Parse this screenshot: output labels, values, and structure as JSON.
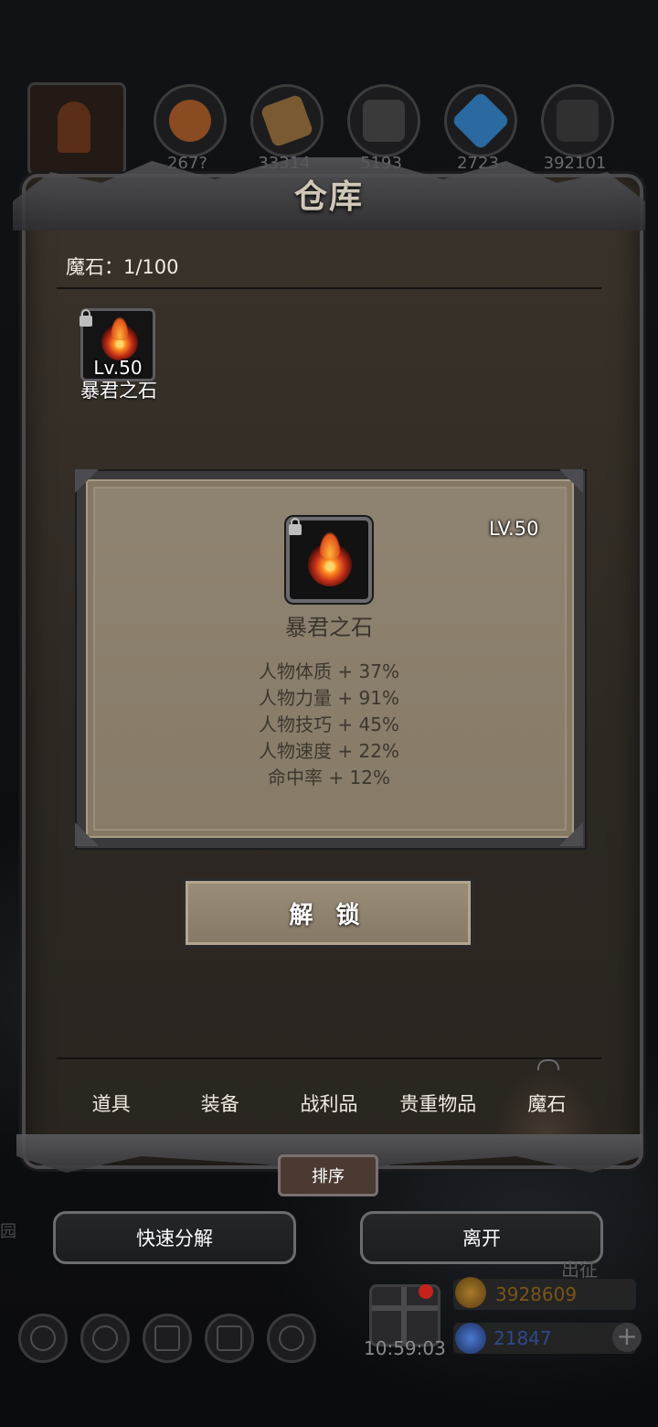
{
  "resources": {
    "items": [
      {
        "value": "",
        "icon": "horn-icon",
        "color": "#5a2e18"
      },
      {
        "value": "267?",
        "icon": "meat-icon",
        "color": "#8a4a22"
      },
      {
        "value": "33314",
        "icon": "wood-icon",
        "color": "#7a5a32"
      },
      {
        "value": "5193",
        "icon": "stone-icon",
        "color": "#3a3a3a"
      },
      {
        "value": "2723",
        "icon": "crystal-icon",
        "color": "#2a6aa0"
      },
      {
        "value": "392101",
        "icon": "iron-icon",
        "color": "#303030"
      }
    ]
  },
  "panel": {
    "title": "仓库",
    "count_label": "魔石：1/100"
  },
  "inventory": {
    "item": {
      "level": "Lv.50",
      "name": "暴君之石",
      "locked": true,
      "icon": "fire-stone-icon"
    }
  },
  "detail": {
    "level": "LV.50",
    "name": "暴君之石",
    "stats": [
      "人物体质 + 37%",
      "人物力量 + 91%",
      "人物技巧 + 45%",
      "人物速度 + 22%",
      "命中率 + 12%"
    ],
    "unlock_label": "解 锁"
  },
  "tabs": [
    {
      "label": "道具",
      "active": false
    },
    {
      "label": "装备",
      "active": false
    },
    {
      "label": "战利品",
      "active": false
    },
    {
      "label": "贵重物品",
      "active": false
    },
    {
      "label": "魔石",
      "active": true
    }
  ],
  "actions": {
    "sort_label": "排序",
    "quick_decompose_label": "快速分解",
    "leave_label": "离开"
  },
  "hud": {
    "timer": "10:59:03",
    "gold": "3928609",
    "gems": "21847",
    "plus": "+",
    "expedition": "出征",
    "side_text": "园"
  },
  "colors": {
    "gold": "#8a5a1a",
    "gem": "#2a4a9a",
    "panel_bg": "#2d2822",
    "card_bg": "#8a7e6b"
  }
}
